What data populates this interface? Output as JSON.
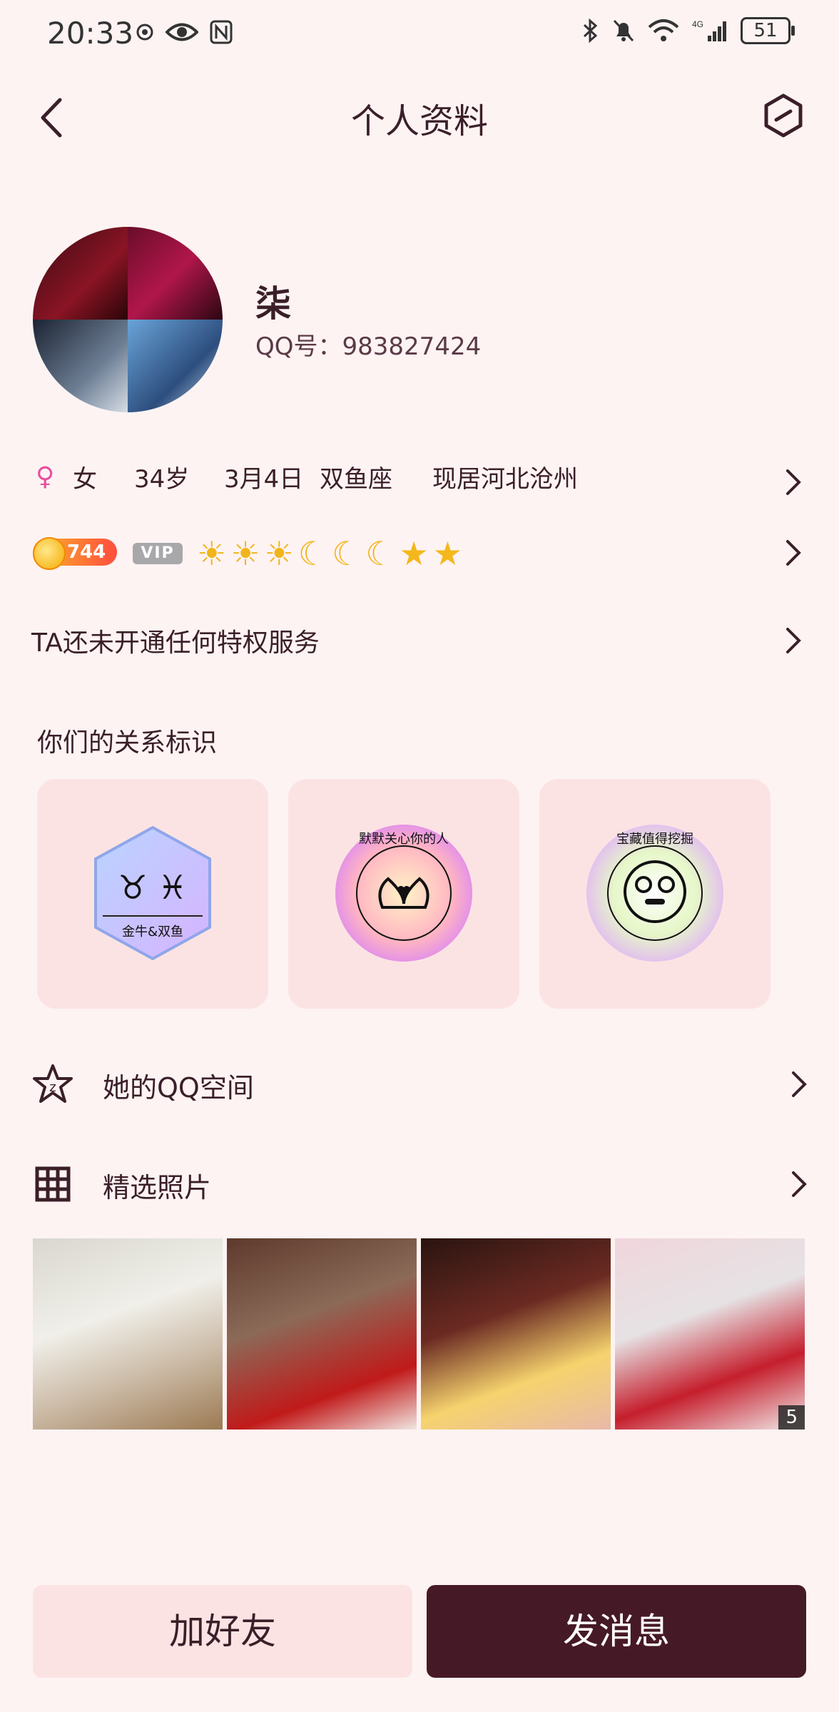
{
  "status": {
    "time": "20:33",
    "battery": "51",
    "network": "4G"
  },
  "nav": {
    "title": "个人资料"
  },
  "profile": {
    "nickname": "柒",
    "qq": "QQ号：983827424"
  },
  "info": {
    "gender_symbol": "♀",
    "gender": "女",
    "age": "34岁",
    "birthday": "3月4日",
    "zodiac": "双鱼座",
    "location": "现居河北沧州"
  },
  "level": {
    "value": "744",
    "vip": "VIP"
  },
  "privilege": {
    "text": "TA还未开通任何特权服务"
  },
  "relation": {
    "title": "你们的关系标识",
    "cards": [
      {
        "label": "金牛&双鱼",
        "symbols": "♉ ♓"
      },
      {
        "label": "默默关心你的人"
      },
      {
        "label": "宝藏值得挖掘"
      }
    ]
  },
  "qzone": {
    "label": "她的QQ空间"
  },
  "photos_section": {
    "label": "精选照片",
    "count": "5"
  },
  "buttons": {
    "add_friend": "加好友",
    "send_message": "发消息"
  },
  "colors": {
    "primary": "#461926",
    "card_bg": "#fce3e3",
    "page_bg": "#fdf3f3"
  }
}
